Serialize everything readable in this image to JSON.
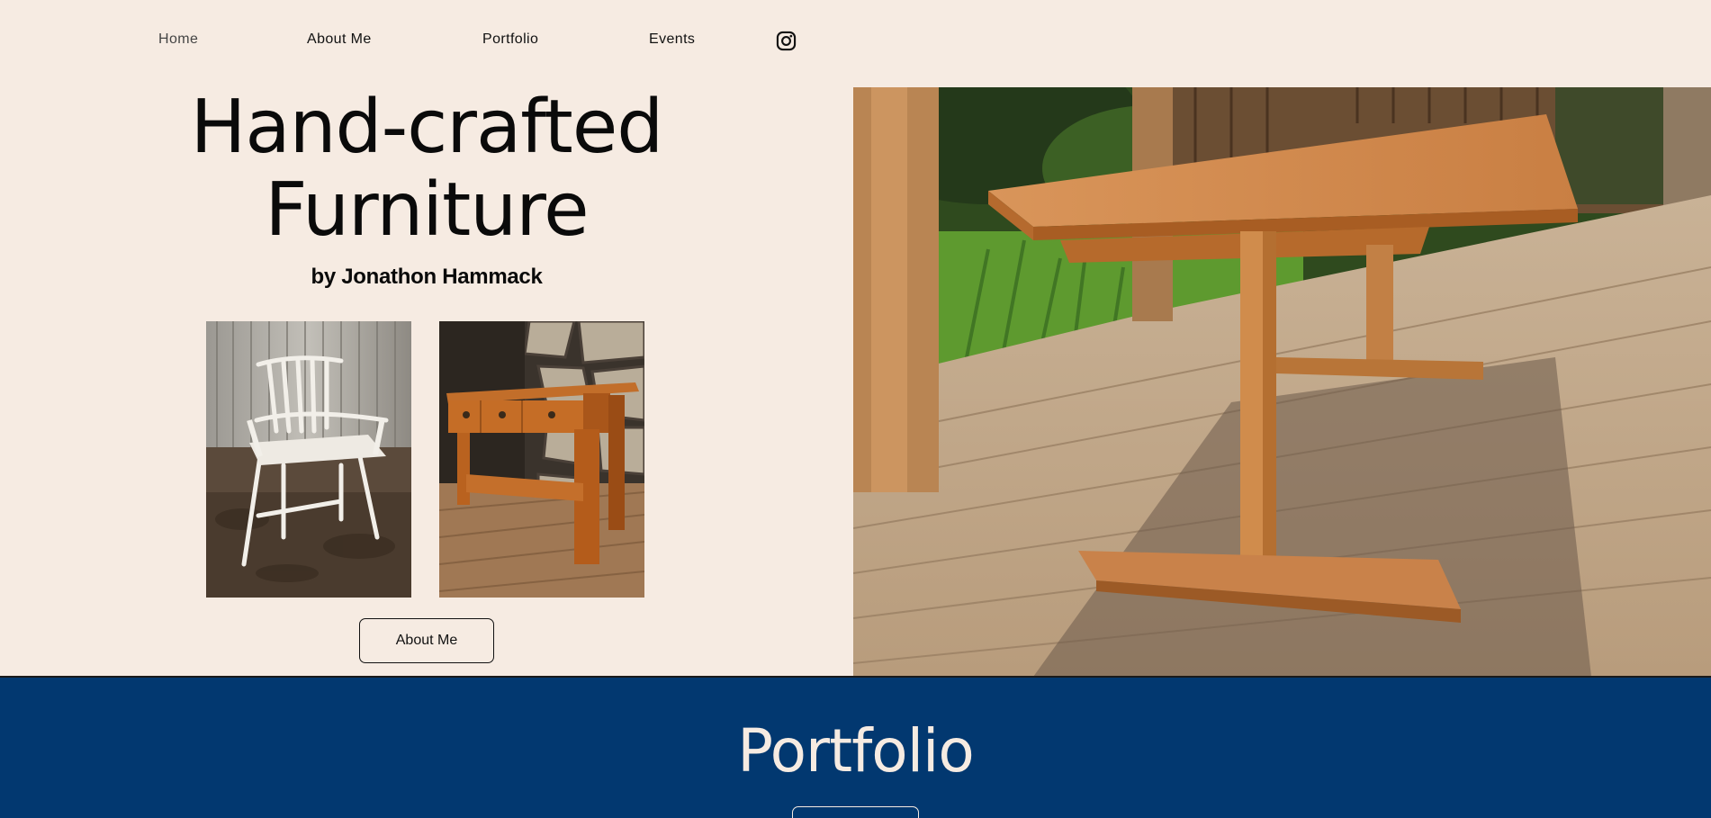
{
  "nav": {
    "items": [
      {
        "label": "Home",
        "active": true
      },
      {
        "label": "About Me"
      },
      {
        "label": "Portfolio"
      },
      {
        "label": "Events"
      }
    ],
    "social_icon": "instagram-icon"
  },
  "hero": {
    "title_line1": "Hand-crafted",
    "title_line2": "Furniture",
    "subtitle": "by Jonathon Hammack",
    "about_button": "About Me",
    "images": [
      "white-windsor-chair-photo",
      "cherry-hall-table-photo",
      "cherry-trestle-table-photo"
    ]
  },
  "portfolio": {
    "title": "Portfolio"
  },
  "colors": {
    "background": "#f6ebe2",
    "band": "#023870",
    "text": "#0a0a0a"
  }
}
